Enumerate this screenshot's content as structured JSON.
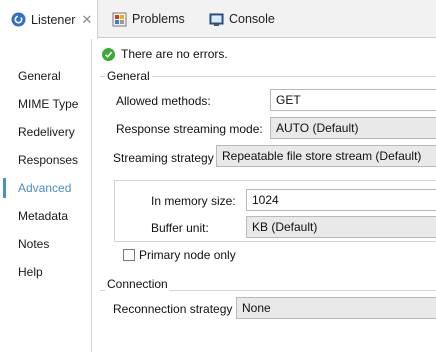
{
  "tabs": [
    {
      "label": "Listener",
      "icon": "listener-icon",
      "active": true
    },
    {
      "label": "Problems",
      "icon": "problems-icon",
      "active": false
    },
    {
      "label": "Console",
      "icon": "console-icon",
      "active": false
    }
  ],
  "tab_close_glyph": "✕",
  "nav": {
    "items": [
      "General",
      "MIME Type",
      "Redelivery",
      "Responses",
      "Advanced",
      "Metadata",
      "Notes",
      "Help"
    ],
    "active_index": 4
  },
  "status": {
    "text": "There are no errors."
  },
  "general": {
    "title": "General",
    "allowed_methods_label": "Allowed methods:",
    "allowed_methods_value": "GET",
    "response_streaming_label": "Response streaming mode:",
    "response_streaming_value": "AUTO (Default)",
    "streaming_strategy_label": "Streaming strategy",
    "streaming_strategy_value": "Repeatable file store stream (Default)",
    "in_memory_label": "In memory size:",
    "in_memory_value": "1024",
    "buffer_unit_label": "Buffer unit:",
    "buffer_unit_value": "KB (Default)",
    "primary_node_label": "Primary node only",
    "primary_node_checked": false
  },
  "connection": {
    "title": "Connection",
    "reconnection_label": "Reconnection strategy",
    "reconnection_value": "None"
  },
  "colors": {
    "accent": "#4a90c8",
    "ok": "#3aaa35"
  }
}
